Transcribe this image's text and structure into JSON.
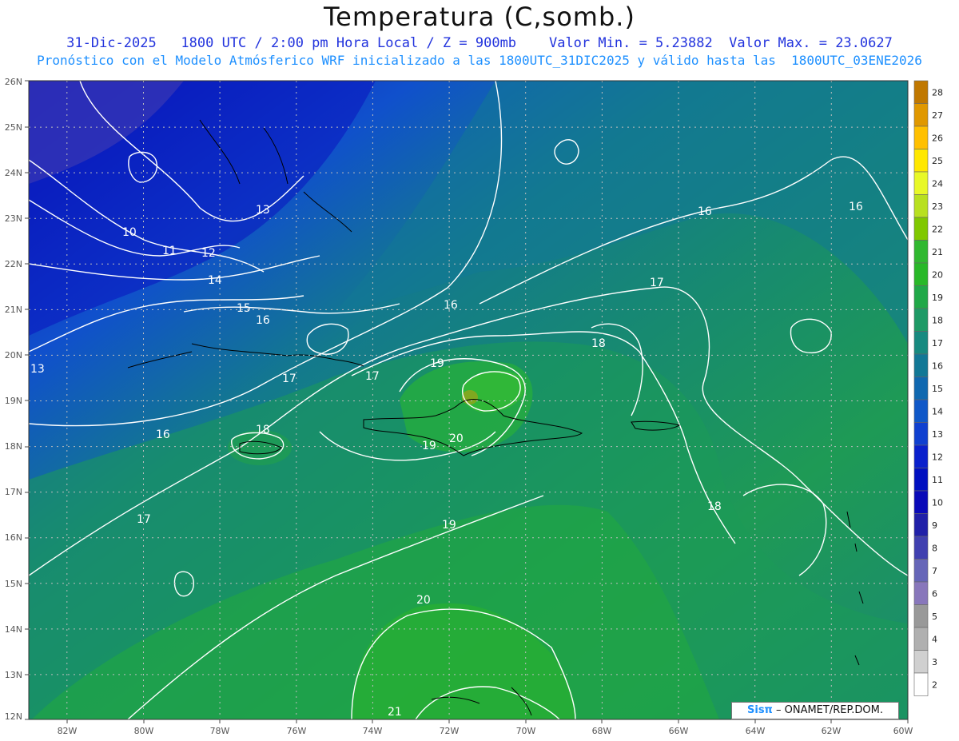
{
  "title": "Temperatura (C,somb.)",
  "subtitle_line1": "31-Dic-2025   1800 UTC / 2:00 pm Hora Local / Z = 900mb    Valor Min. = 5.23882  Valor Max. = 23.0627",
  "subtitle_line2": "Pronóstico con el Modelo Atmósferico WRF inicializado a las 1800UTC_31DIC2025 y válido hasta las  1800UTC_03ENE2026",
  "credit": {
    "brand": "Sisπ",
    "text": " – ONAMET/REP.DOM."
  },
  "map": {
    "lon_range": [
      -83,
      -60
    ],
    "lat_range": [
      12,
      26
    ],
    "lat_labels": [
      "26N",
      "25N",
      "24N",
      "23N",
      "22N",
      "21N",
      "20N",
      "19N",
      "18N",
      "17N",
      "16N",
      "15N",
      "14N",
      "13N",
      "12N"
    ],
    "lon_labels": [
      "82W",
      "80W",
      "78W",
      "76W",
      "74W",
      "72W",
      "70W",
      "68W",
      "66W",
      "64W",
      "62W",
      "60W"
    ],
    "contour_labels": [
      {
        "text": "10"
      },
      {
        "text": "11"
      },
      {
        "text": "12"
      },
      {
        "text": "13"
      },
      {
        "text": "13"
      },
      {
        "text": "14"
      },
      {
        "text": "15"
      },
      {
        "text": "16"
      },
      {
        "text": "16"
      },
      {
        "text": "16"
      },
      {
        "text": "16"
      },
      {
        "text": "16"
      },
      {
        "text": "17"
      },
      {
        "text": "17"
      },
      {
        "text": "17"
      },
      {
        "text": "17"
      },
      {
        "text": "18"
      },
      {
        "text": "18"
      },
      {
        "text": "18"
      },
      {
        "text": "19"
      },
      {
        "text": "19"
      },
      {
        "text": "19"
      },
      {
        "text": "20"
      },
      {
        "text": "20"
      },
      {
        "text": "21"
      }
    ]
  },
  "colorbar": {
    "labels": [
      "28",
      "27",
      "26",
      "25",
      "24",
      "23",
      "22",
      "21",
      "20",
      "19",
      "18",
      "17",
      "16",
      "15",
      "14",
      "13",
      "12",
      "11",
      "10",
      "9",
      "8",
      "7",
      "6",
      "5",
      "4",
      "3",
      "2"
    ],
    "colors": [
      "#c07800",
      "#e09800",
      "#ffc000",
      "#ffe800",
      "#e8f828",
      "#b8e020",
      "#80c800",
      "#30b830",
      "#28b828",
      "#20a848",
      "#1e9a66",
      "#178a80",
      "#127896",
      "#1068b0",
      "#1058c8",
      "#1040d0",
      "#0a20cc",
      "#0010c0",
      "#0a0ab8",
      "#2020a8",
      "#4040b0",
      "#6666b8",
      "#8877bb",
      "#999999",
      "#b0b0b0",
      "#d0d0d0",
      "#ffffff"
    ]
  }
}
